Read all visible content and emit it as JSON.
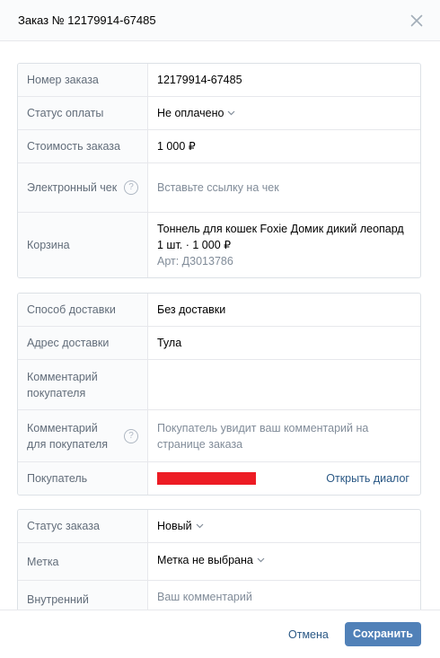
{
  "header": {
    "title": "Заказ № 12179914-67485"
  },
  "order_card": {
    "order_number": {
      "label": "Номер заказа",
      "value": "12179914-67485"
    },
    "payment_status": {
      "label": "Статус оплаты",
      "value": "Не оплачено"
    },
    "order_cost": {
      "label": "Стоимость заказа",
      "value": "1 000 ₽"
    },
    "receipt": {
      "label": "Электронный чек",
      "placeholder": "Вставьте ссылку на чек"
    },
    "cart": {
      "label": "Корзина",
      "product_name": "Тоннель для кошек Foxie Домик дикий леопард",
      "quantity_price": "1 шт. · 1 000 ₽",
      "article": "Арт: Д3013786"
    }
  },
  "delivery_card": {
    "method": {
      "label": "Способ доставки",
      "value": "Без доставки"
    },
    "address": {
      "label": "Адрес доставки",
      "value": "Тула"
    },
    "buyer_comment": {
      "label": "Комментарий покупателя",
      "value": ""
    },
    "comment_for_buyer": {
      "label": "Комментарий для покупателя",
      "placeholder": "Покупатель увидит ваш комментарий на странице заказа"
    },
    "buyer": {
      "label": "Покупатель",
      "open_dialog": "Открыть диалог"
    }
  },
  "status_card": {
    "order_status": {
      "label": "Статус заказа",
      "value": "Новый"
    },
    "tag": {
      "label": "Метка",
      "value": "Метка не выбрана"
    },
    "internal": {
      "label": "Внутренний",
      "placeholder": "Ваш комментарий"
    }
  },
  "footer": {
    "cancel_label": "Отмена",
    "save_label": "Сохранить"
  },
  "colors": {
    "accent": "#5181b8",
    "link": "#2a5885",
    "redaction": "#ed1c24"
  },
  "icons": {
    "close": "close-icon",
    "help": "question-circle-icon",
    "chevron": "chevron-down-icon"
  },
  "help_glyph": "?"
}
